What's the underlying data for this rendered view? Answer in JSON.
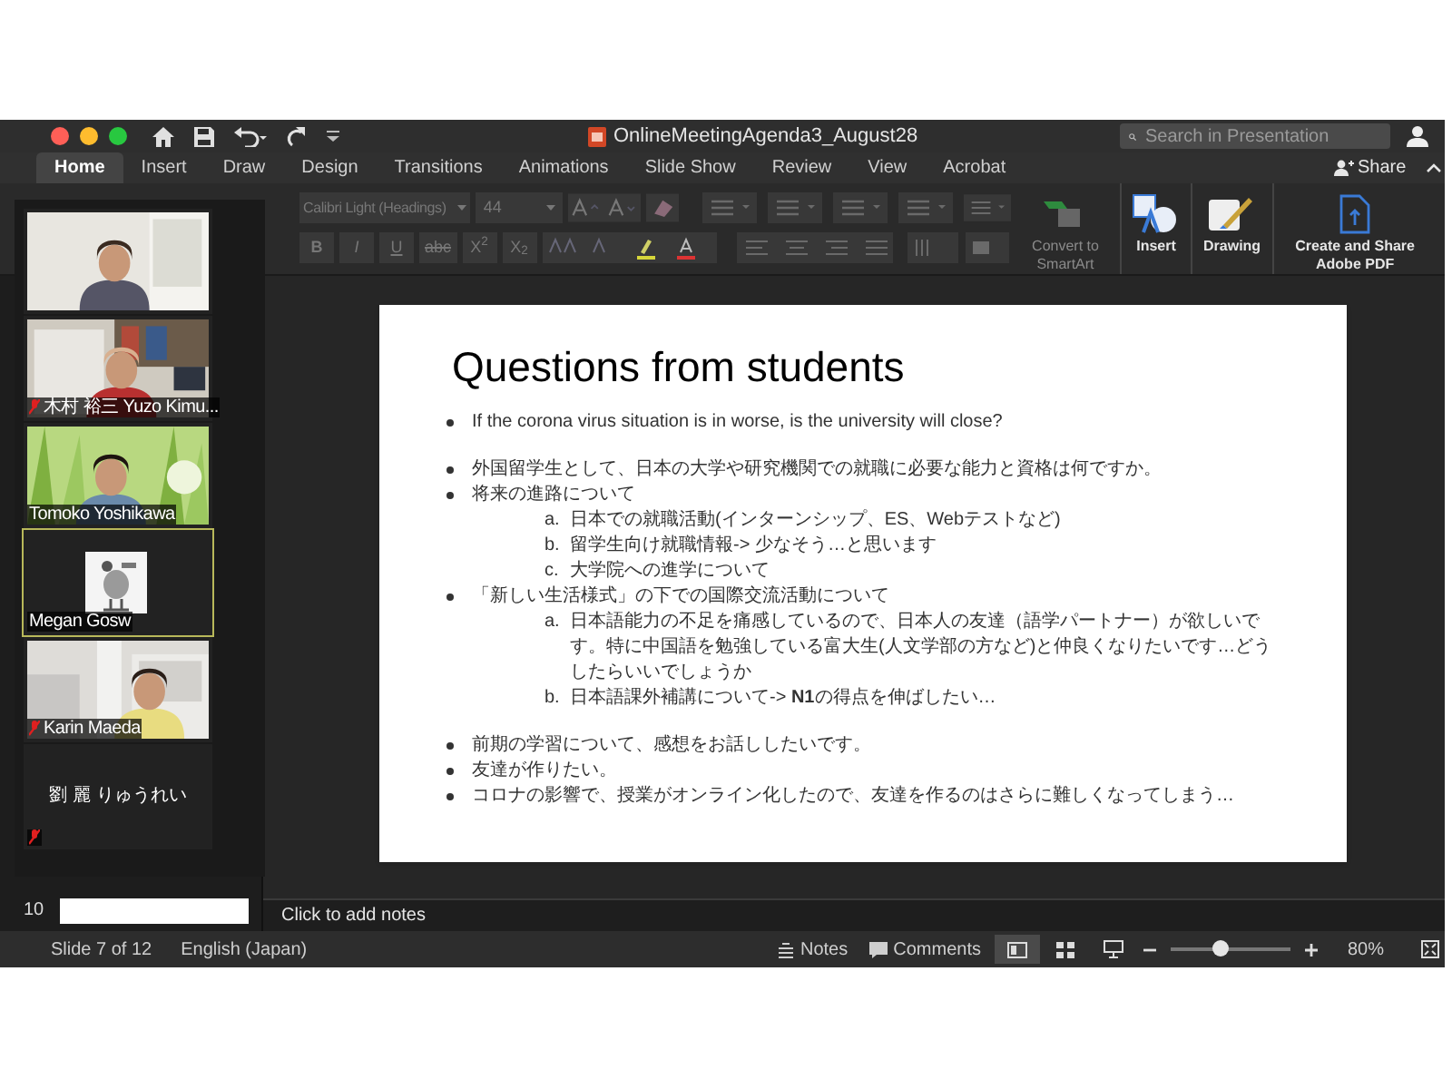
{
  "window": {
    "title": "OnlineMeetingAgenda3_August28"
  },
  "search": {
    "placeholder": "Search in Presentation"
  },
  "tabs": [
    {
      "label": "Home",
      "selected": true
    },
    {
      "label": "Insert",
      "selected": false
    },
    {
      "label": "Draw",
      "selected": false
    },
    {
      "label": "Design",
      "selected": false
    },
    {
      "label": "Transitions",
      "selected": false
    },
    {
      "label": "Animations",
      "selected": false
    },
    {
      "label": "Slide Show",
      "selected": false
    },
    {
      "label": "Review",
      "selected": false
    },
    {
      "label": "View",
      "selected": false
    },
    {
      "label": "Acrobat",
      "selected": false
    }
  ],
  "share": "Share",
  "ribbon": {
    "font": "Calibri Light (Headings)",
    "size": "44",
    "format_buttons": [
      "B",
      "I",
      "U",
      "abc",
      "X$^{2}$",
      "X$_{2}$"
    ],
    "groups": [
      {
        "label": "Convert to SmartArt",
        "disabled": true,
        "kind": "smartart"
      },
      {
        "label": "Insert",
        "disabled": false,
        "kind": "insert"
      },
      {
        "label": "Drawing",
        "disabled": false,
        "kind": "drawing"
      },
      {
        "label": "Create and Share Adobe PDF",
        "disabled": false,
        "kind": "pdf"
      }
    ]
  },
  "participants": [
    {
      "kind": "video",
      "muted": false,
      "selected": false
    },
    {
      "kind": "video",
      "name": "木村 裕三 Yuzo Kimu...",
      "muted": true,
      "selected": false
    },
    {
      "kind": "video",
      "name": "Tomoko Yoshikawa",
      "muted": false,
      "selected": false
    },
    {
      "name": "Megan Gosw",
      "muted": false,
      "selected": true
    },
    {
      "kind": "video",
      "name": "Karin Maeda",
      "muted": true,
      "selected": false
    },
    {
      "kind": "none",
      "name": "劉 麗 りゅうれい",
      "muted": true,
      "selected": false
    }
  ],
  "thumbnails": [
    {
      "number": "10"
    }
  ],
  "slide": {
    "title": "Questions from students",
    "groups": [
      [
        {
          "text": "If the corona virus situation is in worse, is the university will close?"
        }
      ],
      [
        {
          "text": "外国留学生として、日本の大学や研究機関での就職に必要な能力と資格は何ですか。"
        },
        {
          "text": "将来の進路について",
          "children": [
            {
              "marker": "a.",
              "text": "日本での就職活動(インターンシップ、ES、Webテストなど)"
            },
            {
              "marker": "b.",
              "text": "留学生向け就職情報-> 少なそう…と思います"
            },
            {
              "marker": "c.",
              "text": "大学院への進学について"
            }
          ]
        },
        {
          "text": "「新しい生活様式」の下での国際交流活動について",
          "children": [
            {
              "marker": "a.",
              "text": "日本語能力の不足を痛感しているので、日本人の友達（語学パートナー）が欲しいです。特に中国語を勉強している富大生(人文学部の方など)と仲良くなりたいです…どうしたらいいでしょうか"
            },
            {
              "marker": "b.",
              "text": "日本語課外補講について-> **N1**の得点を伸ばしたい…"
            }
          ]
        }
      ],
      [
        {
          "text": "前期の学習について、感想をお話ししたいです。"
        },
        {
          "text": "友達が作りたい。"
        },
        {
          "text": "コロナの影響で、授業がオンライン化したので、友達を作るのはさらに難しくなってしまう…"
        }
      ]
    ]
  },
  "notes_placeholder": "Click to add notes",
  "status": {
    "slide": "Slide 7 of 12",
    "language": "English (Japan)",
    "notes": "Notes",
    "comments": "Comments",
    "zoom": {
      "level": 0.4
    },
    "zoom_reading": "80%"
  }
}
